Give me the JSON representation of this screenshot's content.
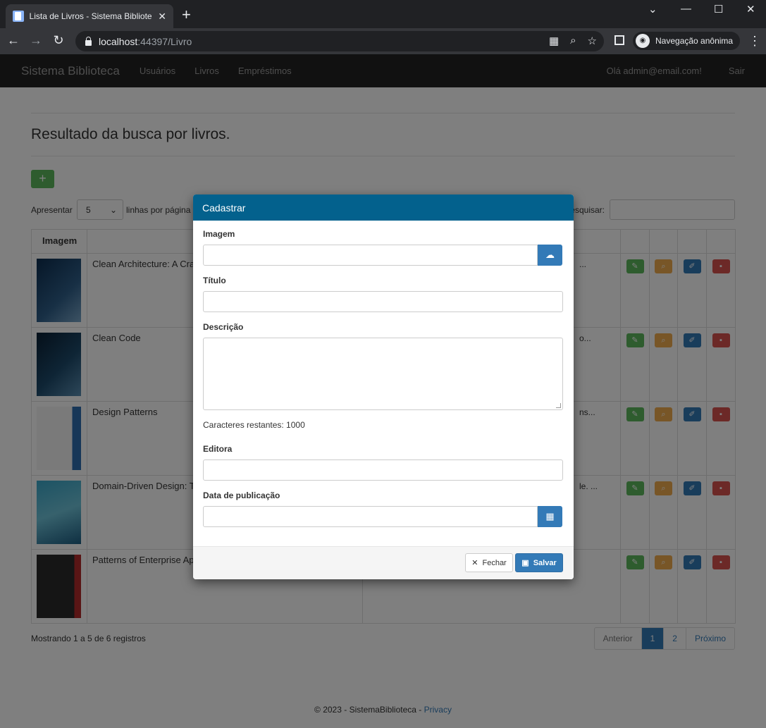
{
  "browser": {
    "tab_title": "Lista de Livros - Sistema Bibliotec",
    "tab_close": "✕",
    "new_tab": "+",
    "win_min": "—",
    "win_max": "☐",
    "win_close": "✕",
    "win_menu": "⌄",
    "url_host": "localhost",
    "url_path": ":44397/Livro",
    "incognito_label": "Navegação anônima",
    "back": "←",
    "forward": "→",
    "reload": "↻"
  },
  "navbar": {
    "brand": "Sistema Biblioteca",
    "links": [
      "Usuários",
      "Livros",
      "Empréstimos"
    ],
    "greeting": "Olá admin@email.com!",
    "logout": "Sair"
  },
  "main": {
    "title": "Resultado da busca por livros.",
    "add_button": "+",
    "show_label": "Apresentar",
    "page_length": "5",
    "rows_per_page": "linhas por página",
    "search_label": "Pesquisar:",
    "table_header_image": "Imagem",
    "rows": [
      {
        "title": "Clean Architecture: A Craft",
        "desc": "..."
      },
      {
        "title": "Clean Code",
        "desc": "o..."
      },
      {
        "title": "Design Patterns",
        "desc": "ns..."
      },
      {
        "title": "Domain-Driven Design: Ta",
        "desc": "le. ..."
      },
      {
        "title": "Patterns of Enterprise App",
        "desc": ""
      }
    ],
    "showing": "Mostrando 1 a 5 de 6 registros",
    "pager": {
      "prev": "Anterior",
      "p1": "1",
      "p2": "2",
      "next": "Próximo"
    }
  },
  "footer": {
    "copyright": "© 2023 - SistemaBiblioteca - ",
    "privacy": "Privacy"
  },
  "modal": {
    "title": "Cadastrar",
    "image_label": "Imagem",
    "title_label": "Título",
    "desc_label": "Descrição",
    "chars_remaining": "Caracteres restantes: 1000",
    "publisher_label": "Editora",
    "pubdate_label": "Data de publicação",
    "close_button": "Fechar",
    "save_button": "Salvar"
  },
  "colors": {
    "modal_header": "#03618d",
    "primary": "#337ab7",
    "success": "#5cb85c",
    "warning": "#f0ad4e",
    "danger": "#d9534f"
  }
}
